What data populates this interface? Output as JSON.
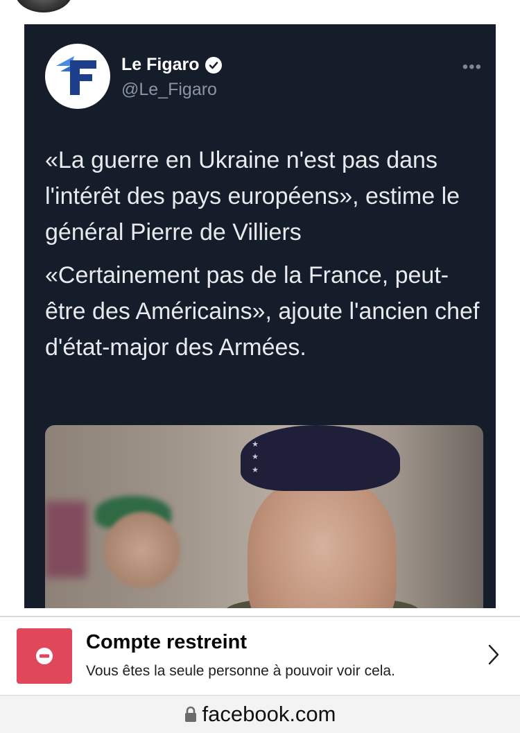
{
  "tweet": {
    "author_name": "Le Figaro",
    "author_handle": "@Le_Figaro",
    "more_label": "•••",
    "paragraphs": [
      "«La guerre en Ukraine n'est pas dans l'intérêt des pays européens», estime le général Pierre de Villiers",
      "«Certainement pas de la France, peut-être des Américains», ajoute l'ancien chef d'état-major des Armées."
    ],
    "verified": true
  },
  "notice": {
    "title": "Compte restreint",
    "subtitle": "Vous êtes la seule personne à pouvoir voir cela."
  },
  "browser": {
    "url": "facebook.com"
  },
  "colors": {
    "tweet_bg": "#151c2a",
    "notice_icon_bg": "#e0475b",
    "figaro_blue": "#1d3e8a"
  }
}
